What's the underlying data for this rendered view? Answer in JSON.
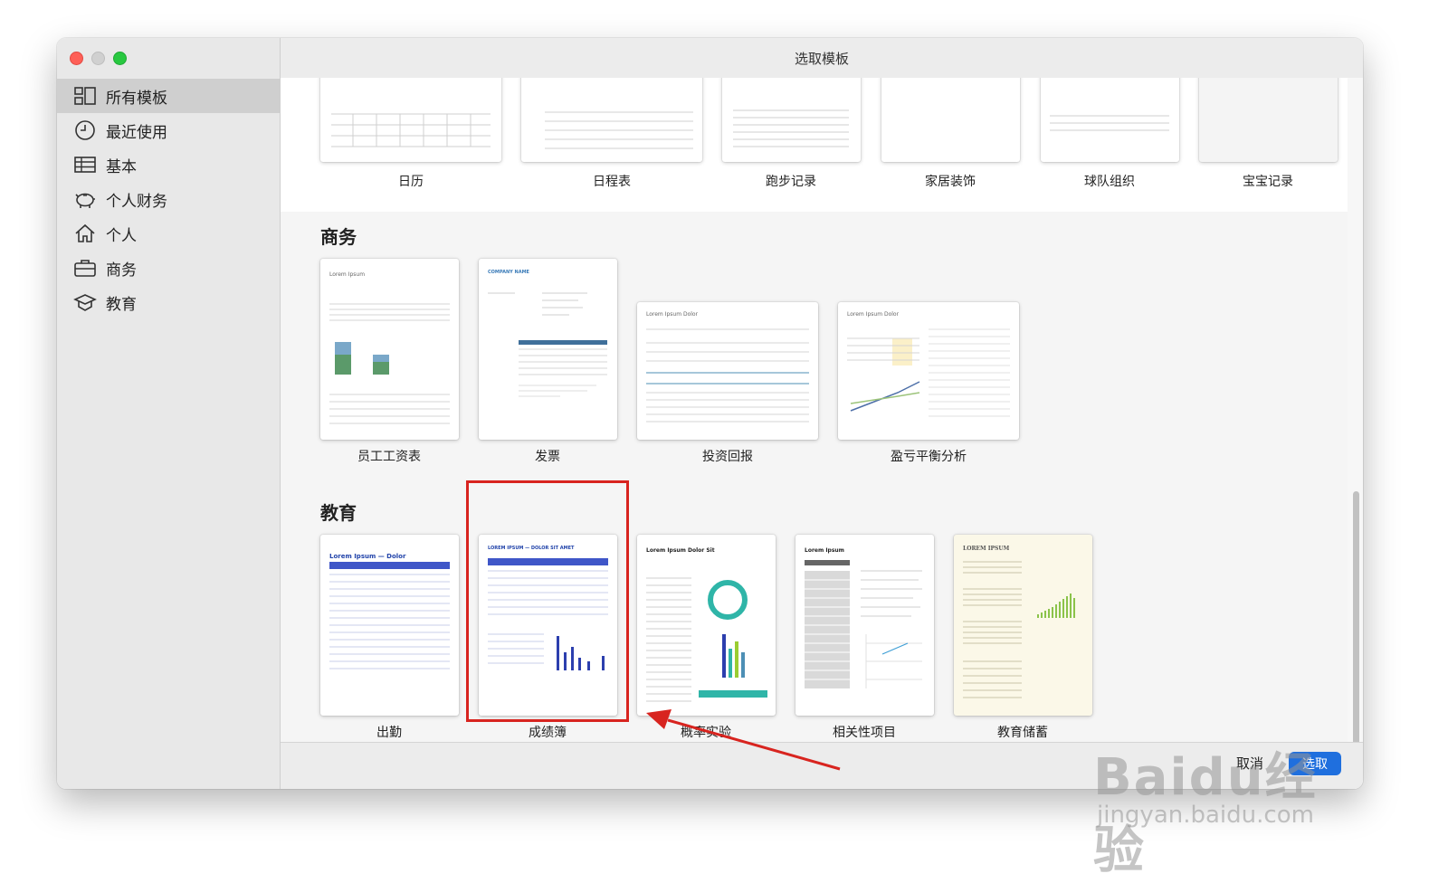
{
  "window": {
    "title": "选取模板"
  },
  "sidebar": {
    "items": [
      {
        "label": "所有模板",
        "icon": "grid-icon",
        "active": true
      },
      {
        "label": "最近使用",
        "icon": "clock-icon"
      },
      {
        "label": "基本",
        "icon": "table-icon"
      },
      {
        "label": "个人财务",
        "icon": "piggy-bank-icon"
      },
      {
        "label": "个人",
        "icon": "house-icon"
      },
      {
        "label": "商务",
        "icon": "briefcase-icon"
      },
      {
        "label": "教育",
        "icon": "graduation-cap-icon"
      }
    ]
  },
  "sections": {
    "personal": {
      "templates": [
        "日历",
        "日程表",
        "跑步记录",
        "家居装饰",
        "球队组织",
        "宝宝记录"
      ]
    },
    "business": {
      "title": "商务",
      "templates": [
        "员工工资表",
        "发票",
        "投资回报",
        "盈亏平衡分析"
      ],
      "thumb_titles": [
        "Lorem Ipsum",
        "COMPANY NAME",
        "Lorem Ipsum Dolor",
        "Lorem Ipsum Dolor"
      ]
    },
    "education": {
      "title": "教育",
      "templates": [
        "出勤",
        "成绩簿",
        "概率实验",
        "相关性项目",
        "教育储蓄"
      ],
      "thumb_titles": [
        "Lorem Ipsum — Dolor",
        "LOREM IPSUM — DOLOR SIT AMET",
        "Lorem Ipsum Dolor Sit",
        "Lorem Ipsum",
        "LOREM IPSUM"
      ]
    }
  },
  "footer": {
    "cancel_label": "取消",
    "choose_label": "选取"
  },
  "watermark": {
    "brand": "Baidu经验",
    "url": "jingyan.baidu.com"
  },
  "annotation": {
    "highlight_color": "#d8241f",
    "highlighted_template": "成绩簿"
  }
}
